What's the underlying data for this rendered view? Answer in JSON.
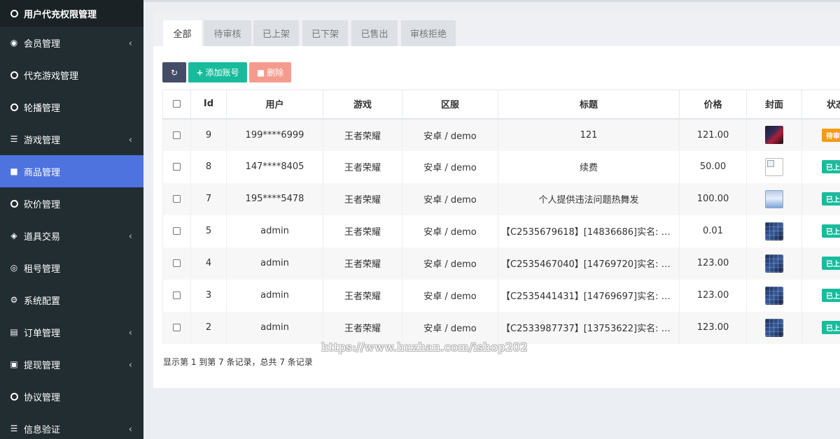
{
  "sidebar": {
    "items": [
      {
        "label": "用户代充权限管理",
        "icon": "circle-icon",
        "chevron": false
      },
      {
        "label": "会员管理",
        "icon": "user-circle-icon",
        "chevron": true
      },
      {
        "label": "代充游戏管理",
        "icon": "circle-icon",
        "chevron": false
      },
      {
        "label": "轮播管理",
        "icon": "circle-icon",
        "chevron": false
      },
      {
        "label": "游戏管理",
        "icon": "list-icon",
        "chevron": true
      },
      {
        "label": "商品管理",
        "icon": "shopping-bag-icon",
        "chevron": false
      },
      {
        "label": "砍价管理",
        "icon": "circle-icon",
        "chevron": false
      },
      {
        "label": "道具交易",
        "icon": "cube-icon",
        "chevron": true
      },
      {
        "label": "租号管理",
        "icon": "clock-icon",
        "chevron": false
      },
      {
        "label": "系统配置",
        "icon": "cogs-icon",
        "chevron": false
      },
      {
        "label": "订单管理",
        "icon": "cart-icon",
        "chevron": true
      },
      {
        "label": "提现管理",
        "icon": "money-icon",
        "chevron": true
      },
      {
        "label": "协议管理",
        "icon": "circle-icon",
        "chevron": false
      },
      {
        "label": "信息验证",
        "icon": "list-icon",
        "chevron": true
      }
    ],
    "active_index": 5,
    "active_color": "#4e73df"
  },
  "tabs": [
    "全部",
    "待审核",
    "已上架",
    "已下架",
    "已售出",
    "审核拒绝"
  ],
  "toolbar": {
    "refresh_icon": "refresh-icon",
    "add_label": "添加账号",
    "delete_label": "删除"
  },
  "table": {
    "columns": [
      "Id",
      "用户",
      "游戏",
      "区服",
      "标题",
      "价格",
      "封面",
      "状态"
    ],
    "rows": [
      {
        "id": "9",
        "user": "199****6999",
        "game": "王者荣耀",
        "server": "安卓 / demo",
        "title": "121",
        "price": "121.00",
        "cover": "dark",
        "status": "待审核",
        "status_type": "warn"
      },
      {
        "id": "8",
        "user": "147****8405",
        "game": "王者荣耀",
        "server": "安卓 / demo",
        "title": "续费",
        "price": "50.00",
        "cover": "broken",
        "status": "已上架",
        "status_type": "ok"
      },
      {
        "id": "7",
        "user": "195****5478",
        "game": "王者荣耀",
        "server": "安卓 / demo",
        "title": "个人提供违法问题热舞发",
        "price": "100.00",
        "cover": "blue",
        "status": "已上架",
        "status_type": "ok"
      },
      {
        "id": "5",
        "user": "admin",
        "game": "王者荣耀",
        "server": "安卓 / demo",
        "title": "【C2535679618】[14836686]实名: 可…",
        "price": "0.01",
        "cover": "grid",
        "status": "已上架",
        "status_type": "ok"
      },
      {
        "id": "4",
        "user": "admin",
        "game": "王者荣耀",
        "server": "安卓 / demo",
        "title": "【C2535467040】[14769720]实名: 可…",
        "price": "123.00",
        "cover": "grid",
        "status": "已上架",
        "status_type": "ok"
      },
      {
        "id": "3",
        "user": "admin",
        "game": "王者荣耀",
        "server": "安卓 / demo",
        "title": "【C2535441431】[14769697]实名: 可…",
        "price": "123.00",
        "cover": "grid",
        "status": "已上架",
        "status_type": "ok"
      },
      {
        "id": "2",
        "user": "admin",
        "game": "王者荣耀",
        "server": "安卓 / demo",
        "title": "【C2533987737】[13753622]实名: 可…",
        "price": "123.00",
        "cover": "grid",
        "status": "已上架",
        "status_type": "ok"
      }
    ]
  },
  "footer": {
    "summary": "显示第 1 到第 7 条记录，总共 7 条记录"
  },
  "watermark": "https://www.huzhan.com/ishop202"
}
